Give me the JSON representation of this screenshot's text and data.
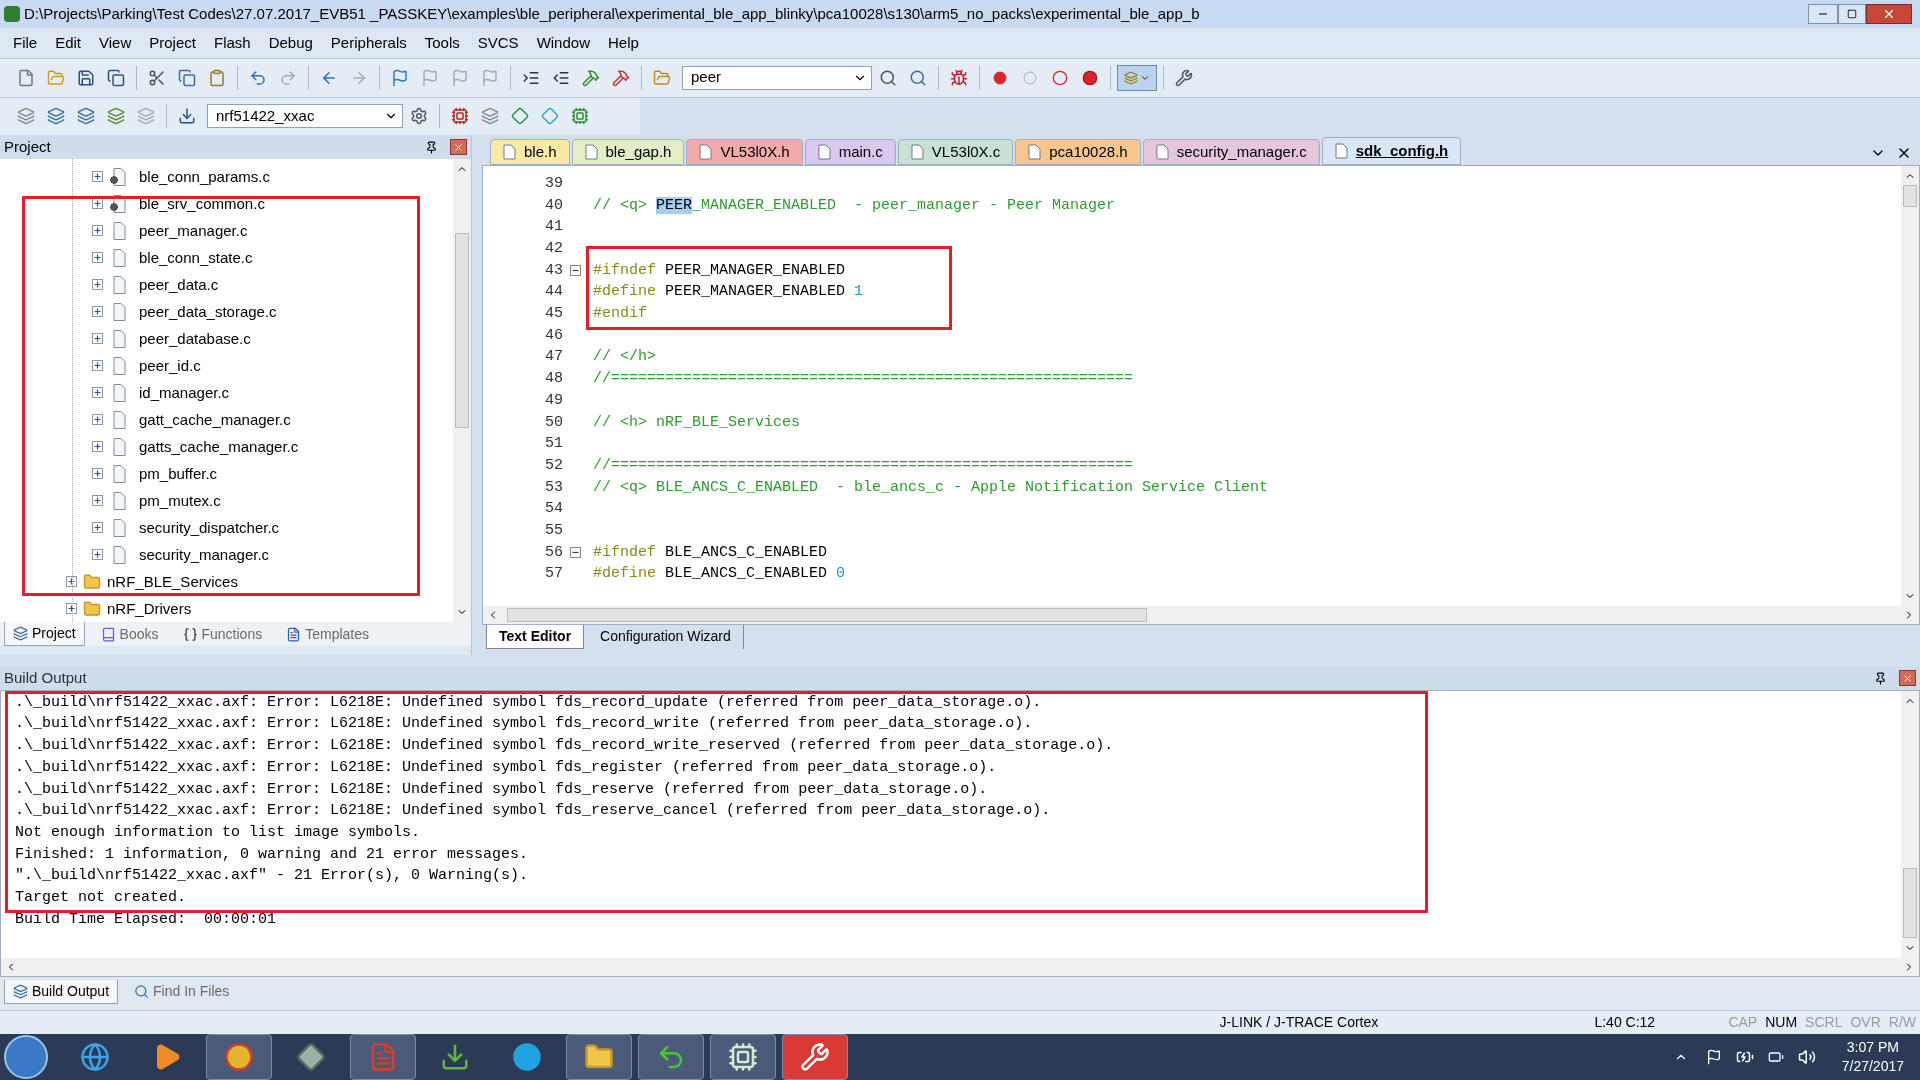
{
  "window": {
    "title": "D:\\Projects\\Parking\\Test Codes\\27.07.2017_EVB51 _PASSKEY\\examples\\ble_peripheral\\experimental_ble_app_blinky\\pca10028\\s130\\arm5_no_packs\\experimental_ble_app_b"
  },
  "menu": [
    "File",
    "Edit",
    "View",
    "Project",
    "Flash",
    "Debug",
    "Peripherals",
    "Tools",
    "SVCS",
    "Window",
    "Help"
  ],
  "toolbar": {
    "find_field": {
      "value": "peer"
    },
    "target_field": {
      "value": "nrf51422_xxac"
    }
  },
  "project_panel": {
    "title": "Project",
    "files": [
      {
        "label": "ble_conn_params.c",
        "kind": "config"
      },
      {
        "label": "ble_srv_common.c",
        "kind": "config"
      },
      {
        "label": "peer_manager.c",
        "kind": "source"
      },
      {
        "label": "ble_conn_state.c",
        "kind": "source"
      },
      {
        "label": "peer_data.c",
        "kind": "source"
      },
      {
        "label": "peer_data_storage.c",
        "kind": "source"
      },
      {
        "label": "peer_database.c",
        "kind": "source"
      },
      {
        "label": "peer_id.c",
        "kind": "source"
      },
      {
        "label": "id_manager.c",
        "kind": "source"
      },
      {
        "label": "gatt_cache_manager.c",
        "kind": "source"
      },
      {
        "label": "gatts_cache_manager.c",
        "kind": "source"
      },
      {
        "label": "pm_buffer.c",
        "kind": "source"
      },
      {
        "label": "pm_mutex.c",
        "kind": "source"
      },
      {
        "label": "security_dispatcher.c",
        "kind": "source"
      },
      {
        "label": "security_manager.c",
        "kind": "source"
      }
    ],
    "folders": [
      {
        "label": "nRF_BLE_Services",
        "expanded": false
      },
      {
        "label": "nRF_Drivers",
        "expanded": false
      }
    ],
    "tabs": [
      {
        "label": "Project",
        "selected": true
      },
      {
        "label": "Books",
        "selected": false
      },
      {
        "label": "Functions",
        "selected": false
      },
      {
        "label": "Templates",
        "selected": false
      }
    ]
  },
  "editor": {
    "tabs": [
      {
        "label": "ble.h",
        "color": "#fbe9a6",
        "selected": false
      },
      {
        "label": "ble_gap.h",
        "color": "#e3edc6",
        "selected": false
      },
      {
        "label": "VL53l0X.h",
        "color": "#f2aaaa",
        "selected": false
      },
      {
        "label": "main.c",
        "color": "#d9c9ee",
        "selected": false
      },
      {
        "label": "VL53l0X.c",
        "color": "#c9e1d2",
        "selected": false
      },
      {
        "label": "pca10028.h",
        "color": "#f7c58e",
        "selected": false
      },
      {
        "label": "security_manager.c",
        "color": "#e6c6da",
        "selected": false
      },
      {
        "label": "sdk_config.h",
        "color": "#d8e6f5",
        "selected": true
      }
    ],
    "lines": [
      {
        "number": "39"
      },
      {
        "number": "40",
        "tokens": [
          {
            "kind": "comment",
            "text": "// <q> "
          },
          {
            "kind": "selected",
            "text": "PEER"
          },
          {
            "kind": "comment",
            "text": "_MANAGER_ENABLED  - peer_manager - Peer Manager"
          }
        ]
      },
      {
        "number": "41"
      },
      {
        "number": "42"
      },
      {
        "number": "43",
        "fold_marker": true,
        "tokens": [
          {
            "kind": "directive",
            "text": "#ifndef"
          },
          {
            "kind": "plain",
            "text": " PEER_MANAGER_ENABLED"
          }
        ]
      },
      {
        "number": "44",
        "tokens": [
          {
            "kind": "directive",
            "text": "#define"
          },
          {
            "kind": "plain",
            "text": " PEER_MANAGER_ENABLED "
          },
          {
            "kind": "number",
            "text": "1"
          }
        ]
      },
      {
        "number": "45",
        "tokens": [
          {
            "kind": "directive",
            "text": "#endif"
          }
        ]
      },
      {
        "number": "46"
      },
      {
        "number": "47",
        "tokens": [
          {
            "kind": "comment",
            "text": "// </h>"
          }
        ]
      },
      {
        "number": "48",
        "tokens": [
          {
            "kind": "comment",
            "text": "//=========================================================="
          }
        ]
      },
      {
        "number": "49"
      },
      {
        "number": "50",
        "tokens": [
          {
            "kind": "comment",
            "text": "// <h> nRF_BLE_Services"
          }
        ]
      },
      {
        "number": "51"
      },
      {
        "number": "52",
        "tokens": [
          {
            "kind": "comment",
            "text": "//=========================================================="
          }
        ]
      },
      {
        "number": "53",
        "tokens": [
          {
            "kind": "comment",
            "text": "// <q> BLE_ANCS_C_ENABLED  - ble_ancs_c - Apple Notification Service Client"
          }
        ]
      },
      {
        "number": "54"
      },
      {
        "number": "55"
      },
      {
        "number": "56",
        "fold_marker": true,
        "tokens": [
          {
            "kind": "directive",
            "text": "#ifndef"
          },
          {
            "kind": "plain",
            "text": " BLE_ANCS_C_ENABLED"
          }
        ]
      },
      {
        "number": "57",
        "tokens": [
          {
            "kind": "directive",
            "text": "#define"
          },
          {
            "kind": "plain",
            "text": " BLE_ANCS_C_ENABLED "
          },
          {
            "kind": "number",
            "text": "0"
          }
        ]
      }
    ],
    "bottom_tabs": [
      {
        "label": "Text Editor",
        "selected": true
      },
      {
        "label": "Configuration Wizard",
        "selected": false
      }
    ]
  },
  "build_output": {
    "title": "Build Output",
    "lines": [
      ".\\_build\\nrf51422_xxac.axf: Error: L6218E: Undefined symbol fds_record_update (referred from peer_data_storage.o).",
      ".\\_build\\nrf51422_xxac.axf: Error: L6218E: Undefined symbol fds_record_write (referred from peer_data_storage.o).",
      ".\\_build\\nrf51422_xxac.axf: Error: L6218E: Undefined symbol fds_record_write_reserved (referred from peer_data_storage.o).",
      ".\\_build\\nrf51422_xxac.axf: Error: L6218E: Undefined symbol fds_register (referred from peer_data_storage.o).",
      ".\\_build\\nrf51422_xxac.axf: Error: L6218E: Undefined symbol fds_reserve (referred from peer_data_storage.o).",
      ".\\_build\\nrf51422_xxac.axf: Error: L6218E: Undefined symbol fds_reserve_cancel (referred from peer_data_storage.o).",
      "Not enough information to list image symbols.",
      "Finished: 1 information, 0 warning and 21 error messages.",
      "\".\\_build\\nrf51422_xxac.axf\" - 21 Error(s), 0 Warning(s).",
      "Target not created.",
      "Build Time Elapsed:  00:00:01"
    ],
    "tabs": [
      {
        "label": "Build Output",
        "selected": true
      },
      {
        "label": "Find In Files",
        "selected": false
      }
    ]
  },
  "status_bar": {
    "debugger": "J-LINK / J-TRACE Cortex",
    "position": "L:40 C:12",
    "indicators": [
      {
        "label": "CAP",
        "on": false
      },
      {
        "label": "NUM",
        "on": true
      },
      {
        "label": "SCRL",
        "on": false
      },
      {
        "label": "OVR",
        "on": false
      },
      {
        "label": "R/W",
        "on": false
      }
    ]
  },
  "taskbar": {
    "time": "3:07 PM",
    "date": "7/27/2017"
  },
  "annotations": [
    {
      "kind": "box"
    },
    {
      "kind": "box"
    },
    {
      "kind": "box"
    }
  ]
}
